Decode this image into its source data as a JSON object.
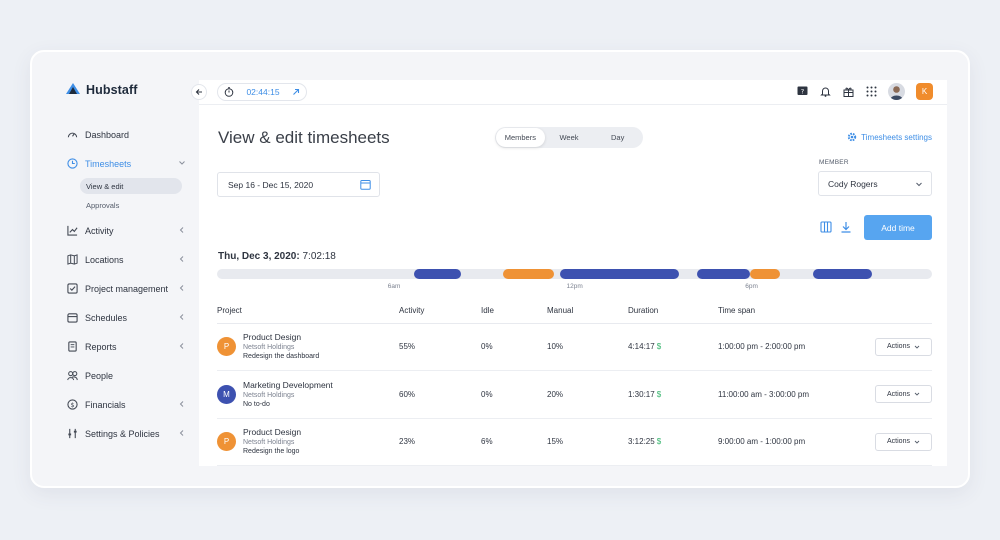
{
  "app": {
    "name": "Hubstaff",
    "brand_color": "#3e8ee6"
  },
  "sidebar": {
    "items": [
      {
        "label": "Dashboard",
        "icon": "dashboard-icon"
      },
      {
        "label": "Timesheets",
        "icon": "clock-icon",
        "active": true,
        "children": [
          {
            "label": "View & edit",
            "selected": true
          },
          {
            "label": "Approvals"
          }
        ]
      },
      {
        "label": "Activity",
        "icon": "chart-icon"
      },
      {
        "label": "Locations",
        "icon": "map-icon"
      },
      {
        "label": "Project management",
        "icon": "checkbox-icon"
      },
      {
        "label": "Schedules",
        "icon": "calendar-icon"
      },
      {
        "label": "Reports",
        "icon": "report-icon"
      },
      {
        "label": "People",
        "icon": "people-icon"
      },
      {
        "label": "Financials",
        "icon": "dollar-icon"
      },
      {
        "label": "Settings & Policies",
        "icon": "sliders-icon"
      }
    ]
  },
  "topbar": {
    "timer": "02:44:15",
    "avatar_initial": "K"
  },
  "page": {
    "title": "View & edit timesheets",
    "view_tabs": [
      {
        "label": "Members",
        "active": true
      },
      {
        "label": "Week"
      },
      {
        "label": "Day"
      }
    ],
    "settings_link": "Timesheets settings",
    "date_range": "Sep 16 - Dec 15, 2020",
    "member_label": "MEMBER",
    "member_value": "Cody Rogers",
    "add_time": "Add time",
    "day_prefix": "Thu, Dec 3, 2020:",
    "day_total": "7:02:18",
    "timeline": {
      "ticks": [
        "6am",
        "12pm",
        "6pm"
      ],
      "segments": [
        {
          "start_hour": 6.6,
          "end_hour": 8.2,
          "kind": "tracked",
          "color": "#3d51b0"
        },
        {
          "start_hour": 9.6,
          "end_hour": 11.3,
          "kind": "manual",
          "color": "#ef9235"
        },
        {
          "start_hour": 11.5,
          "end_hour": 15.5,
          "kind": "tracked",
          "color": "#3d51b0"
        },
        {
          "start_hour": 16.1,
          "end_hour": 17.9,
          "kind": "tracked",
          "color": "#3d51b0"
        },
        {
          "start_hour": 17.9,
          "end_hour": 18.9,
          "kind": "manual",
          "color": "#ef9235"
        },
        {
          "start_hour": 20.0,
          "end_hour": 22.0,
          "kind": "tracked",
          "color": "#3d51b0"
        }
      ]
    }
  },
  "table": {
    "headers": [
      "Project",
      "Activity",
      "Idle",
      "Manual",
      "Duration",
      "Time span"
    ],
    "action_label": "Actions",
    "rows": [
      {
        "badge": "P",
        "badge_color": "#ef9235",
        "project": "Product Design",
        "client": "Netsoft Holdings",
        "task": "Redesign the dashboard",
        "activity": "55%",
        "idle": "0%",
        "manual": "10%",
        "duration": "4:14:17",
        "currency": "$",
        "span": "1:00:00 pm - 2:00:00 pm"
      },
      {
        "badge": "M",
        "badge_color": "#3d51b0",
        "project": "Marketing Development",
        "client": "Netsoft Holdings",
        "task": "No to-do",
        "activity": "60%",
        "idle": "0%",
        "manual": "20%",
        "duration": "1:30:17",
        "currency": "$",
        "span": "11:00:00 am - 3:00:00 pm"
      },
      {
        "badge": "P",
        "badge_color": "#ef9235",
        "project": "Product Design",
        "client": "Netsoft Holdings",
        "task": "Redesign the logo",
        "activity": "23%",
        "idle": "6%",
        "manual": "15%",
        "duration": "3:12:25",
        "currency": "$",
        "span": "9:00:00 am - 1:00:00 pm"
      }
    ]
  }
}
